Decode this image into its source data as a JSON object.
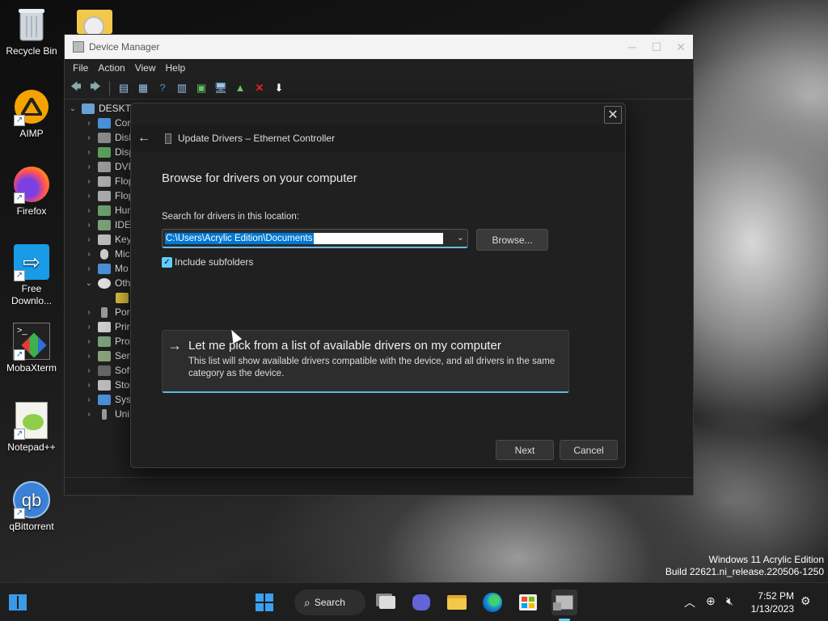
{
  "desktop": {
    "icons": [
      {
        "label": "Recycle Bin",
        "icon": "recycle-bin-icon"
      },
      {
        "label": "AIMP",
        "icon": "aimp-icon"
      },
      {
        "label": "Firefox",
        "icon": "firefox-icon"
      },
      {
        "label": "Free Downlo...",
        "icon": "free-download-manager-icon"
      },
      {
        "label": "MobaXterm",
        "icon": "mobaxterm-icon"
      },
      {
        "label": "Notepad++",
        "icon": "notepad-plus-plus-icon"
      },
      {
        "label": "qBittorrent",
        "icon": "qbittorrent-icon"
      }
    ]
  },
  "device_manager": {
    "title": "Device Manager",
    "menu": [
      "File",
      "Action",
      "View",
      "Help"
    ],
    "tree": [
      {
        "label": "DESKTO",
        "expanded": true,
        "level": 0
      },
      {
        "label": "Cor",
        "level": 1
      },
      {
        "label": "Disk",
        "level": 1
      },
      {
        "label": "Disp",
        "level": 1
      },
      {
        "label": "DVD",
        "level": 1
      },
      {
        "label": "Flop",
        "level": 1
      },
      {
        "label": "Flop",
        "level": 1
      },
      {
        "label": "Hun",
        "level": 1
      },
      {
        "label": "IDE",
        "level": 1
      },
      {
        "label": "Key",
        "level": 1
      },
      {
        "label": "Mic",
        "level": 1
      },
      {
        "label": "Mo",
        "level": 1
      },
      {
        "label": "Oth",
        "expanded": true,
        "level": 1
      },
      {
        "label": "",
        "level": 2
      },
      {
        "label": "Por",
        "level": 1
      },
      {
        "label": "Prir",
        "level": 1
      },
      {
        "label": "Pro",
        "level": 1
      },
      {
        "label": "Sen",
        "level": 1
      },
      {
        "label": "Soft",
        "level": 1
      },
      {
        "label": "Stor",
        "level": 1
      },
      {
        "label": "Syst",
        "level": 1
      },
      {
        "label": "Uni",
        "level": 1
      }
    ]
  },
  "dialog": {
    "title": "Update Drivers – Ethernet Controller",
    "heading": "Browse for drivers on your computer",
    "search_label": "Search for drivers in this location:",
    "path_value": "C:\\Users\\Acrylic Edition\\Documents",
    "browse_label": "Browse...",
    "include_subfolders_label": "Include subfolders",
    "include_subfolders_checked": true,
    "pick_title": "Let me pick from a list of available drivers on my computer",
    "pick_desc": "This list will show available drivers compatible with the device, and all drivers in the same category as the device.",
    "next_label": "Next",
    "cancel_label": "Cancel"
  },
  "watermark": {
    "line1": "Windows 11 Acrylic Edition",
    "line2": "Build 22621.ni_release.220506-1250"
  },
  "taskbar": {
    "search_label": "Search",
    "time": "7:52 PM",
    "date": "1/13/2023"
  },
  "colors": {
    "accent": "#60cdff",
    "selection": "#0078d4"
  }
}
